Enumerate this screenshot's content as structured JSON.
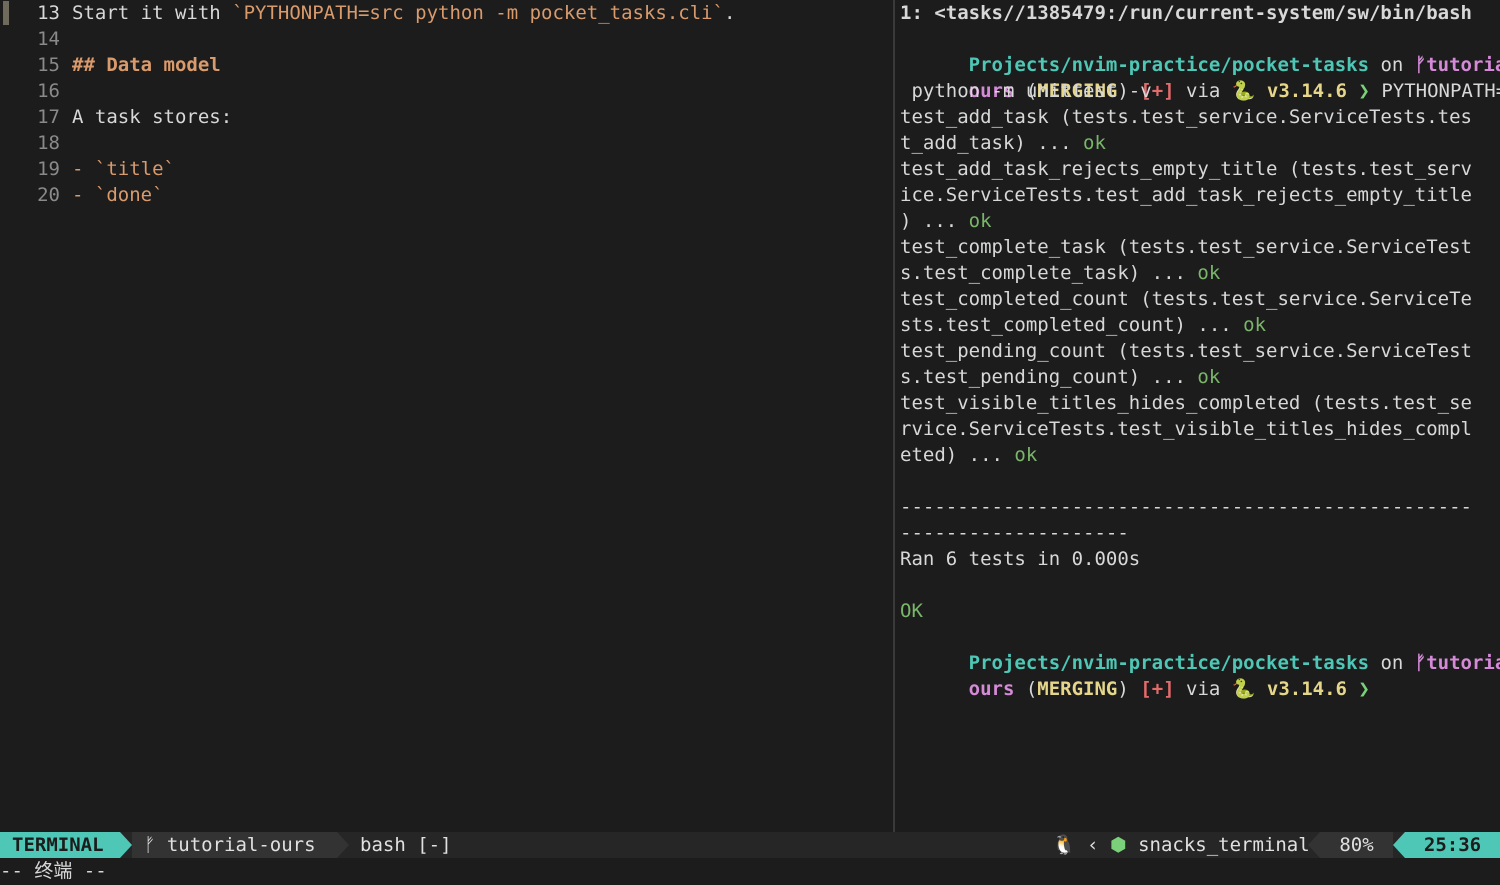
{
  "editor": {
    "lines": [
      {
        "num": "13",
        "current": true,
        "parts": [
          {
            "text": "Start it with ",
            "style": "plain"
          },
          {
            "text": "`PYTHONPATH=src python -m pocket_tasks.cli`",
            "style": "code"
          },
          {
            "text": ".",
            "style": "plain"
          }
        ]
      },
      {
        "num": "14",
        "parts": []
      },
      {
        "num": "15",
        "parts": [
          {
            "text": "## Data model",
            "style": "heading"
          }
        ]
      },
      {
        "num": "16",
        "parts": []
      },
      {
        "num": "17",
        "parts": [
          {
            "text": "A task stores:",
            "style": "plain"
          }
        ]
      },
      {
        "num": "18",
        "parts": []
      },
      {
        "num": "19",
        "parts": [
          {
            "text": "- ",
            "style": "dash"
          },
          {
            "text": "`title`",
            "style": "code"
          }
        ]
      },
      {
        "num": "20",
        "parts": [
          {
            "text": "- ",
            "style": "dash"
          },
          {
            "text": "`done`",
            "style": "code"
          }
        ]
      }
    ]
  },
  "terminal": {
    "title": "1: <tasks//1385479:/run/current-system/sw/bin/bash",
    "prompt": {
      "path": "Projects/nvim-practice/pocket-tasks",
      "on": " on ",
      "branch_icon": "git-branch-icon",
      "branch_wrap1": "tutorial-",
      "branch_wrap2": "ours",
      "paren_open": " (",
      "merging": "MERGING",
      "paren_close": ") ",
      "plus": "[+]",
      "via": " via ",
      "python_icon": "🐍",
      "pyver": " v3.14.6 ",
      "chevron": "❯"
    },
    "command1": " PYTHONPATH=src",
    "command2": " python -m unittest -v",
    "output": [
      {
        "text": "test_add_task (tests.test_service.ServiceTests.tes",
        "ok": ""
      },
      {
        "text": "t_add_task) ... ",
        "ok": "ok"
      },
      {
        "text": "test_add_task_rejects_empty_title (tests.test_serv",
        "ok": ""
      },
      {
        "text": "ice.ServiceTests.test_add_task_rejects_empty_title",
        "ok": ""
      },
      {
        "text": ") ... ",
        "ok": "ok"
      },
      {
        "text": "test_complete_task (tests.test_service.ServiceTest",
        "ok": ""
      },
      {
        "text": "s.test_complete_task) ... ",
        "ok": "ok"
      },
      {
        "text": "test_completed_count (tests.test_service.ServiceTe",
        "ok": ""
      },
      {
        "text": "sts.test_completed_count) ... ",
        "ok": "ok"
      },
      {
        "text": "test_pending_count (tests.test_service.ServiceTest",
        "ok": ""
      },
      {
        "text": "s.test_pending_count) ... ",
        "ok": "ok"
      },
      {
        "text": "test_visible_titles_hides_completed (tests.test_se",
        "ok": ""
      },
      {
        "text": "rvice.ServiceTests.test_visible_titles_hides_compl",
        "ok": ""
      },
      {
        "text": "eted) ... ",
        "ok": "ok"
      }
    ],
    "separator1": "--------------------------------------------------",
    "separator2": "--------------------",
    "ran": "Ran 6 tests in 0.000s",
    "result": "OK"
  },
  "statusline": {
    "mode": "TERMINAL",
    "branch": "tutorial-ours",
    "file": "bash [-]",
    "linux_icon": "linux-icon",
    "filetype_icon": "neovim-icon",
    "filetype": "snacks_terminal",
    "percent": "80%",
    "position": "25:36"
  },
  "cmdline": {
    "text": "-- 终端 --"
  },
  "colors": {
    "accent": "#4fc7b6",
    "branch": "#d58ad8",
    "warning": "#e6d68a",
    "error": "#e36b6b",
    "ok": "#7ab66a"
  }
}
